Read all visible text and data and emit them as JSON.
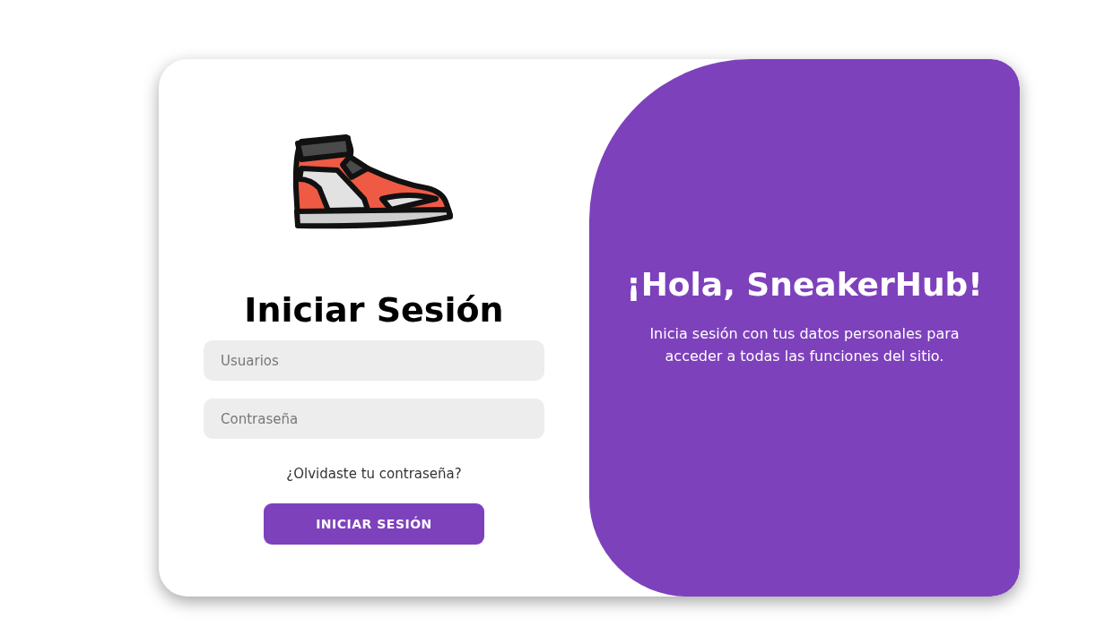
{
  "login": {
    "title": "Iniciar Sesión",
    "fields": [
      {
        "placeholder": "Usuarios"
      },
      {
        "placeholder": "Contraseña"
      }
    ],
    "forgot_link": "¿Olvidaste tu contraseña?",
    "submit": "INICIAR SESIÓN"
  },
  "welcome": {
    "title": "¡Hola, SneakerHub!",
    "text": "Inicia sesión con tus datos personales para acceder a todas las funciones del sitio."
  }
}
